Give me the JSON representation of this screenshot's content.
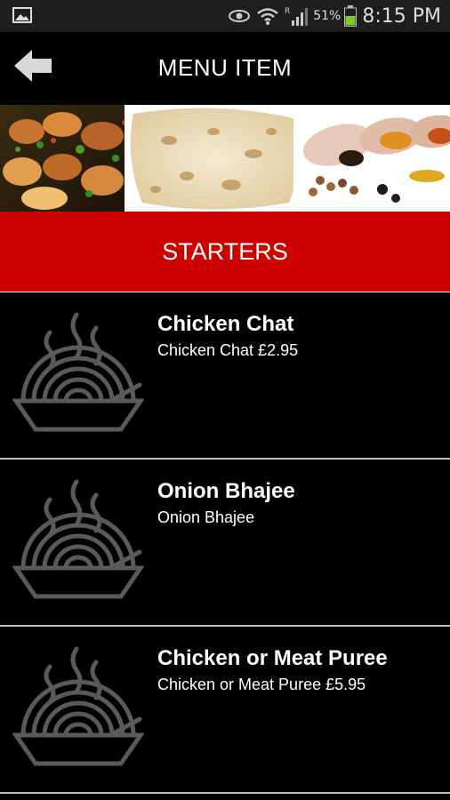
{
  "status_bar": {
    "battery_percent": "51%",
    "time": "8:15 PM",
    "icons": [
      "gallery-icon",
      "eye-icon",
      "wifi-icon",
      "signal-icon",
      "battery-icon"
    ]
  },
  "header": {
    "title": "MENU ITEM",
    "back_icon": "back-arrow-icon"
  },
  "banner": {
    "image": "food-banner (tikka, naan bread, spices)"
  },
  "category": {
    "title": "STARTERS"
  },
  "menu_items": [
    {
      "name": "Chicken Chat",
      "description": "Chicken Chat £2.95",
      "icon": "food-bowl-icon"
    },
    {
      "name": "Onion Bhajee",
      "description": "Onion Bhajee",
      "icon": "food-bowl-icon"
    },
    {
      "name": "Chicken or Meat Puree",
      "description": "Chicken or Meat Puree £5.95",
      "icon": "food-bowl-icon"
    }
  ],
  "colors": {
    "accent_red": "#cc0000",
    "background": "#000000",
    "divider": "#bdbdbd",
    "icon_gray": "#555555"
  }
}
